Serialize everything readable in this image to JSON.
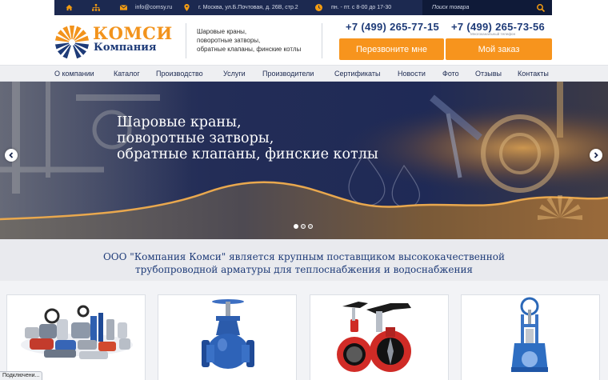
{
  "topbar": {
    "email": "info@comsy.ru",
    "address": "г. Москва, ул.Б.Почтовая, д. 26В, стр.2",
    "hours": "пн. - пт. с 8-00 до 17-30",
    "search_placeholder": "Поиск товара",
    "icon_color": "#f39c12"
  },
  "header": {
    "brand_line1": "КОМСИ",
    "brand_line2": "Компания",
    "tagline_1": "Шаровые краны,",
    "tagline_2": "поворотные затворы,",
    "tagline_3": "обратные клапаны, финские котлы",
    "phone_1": "+7 (499) 265-77-15",
    "phone_2": "+7 (499) 265-73-56",
    "phone_2_note": "Многоканальный телефон",
    "callback_label": "Перезвоните мне",
    "order_label": "Мой заказ",
    "accent_color": "#f7941d",
    "brand_color": "#1e3b78"
  },
  "nav": {
    "items": [
      "О компании",
      "Каталог",
      "Производство",
      "Услуги",
      "Производители",
      "Сертификаты",
      "Новости",
      "Фото",
      "Отзывы",
      "Контакты"
    ]
  },
  "hero": {
    "line_1": "Шаровые краны,",
    "line_2": "поворотные затворы,",
    "line_3": "обратные клапаны, финские котлы",
    "slide_count": 3,
    "active_slide": 1
  },
  "intro": {
    "line_1": "ООО \"Компания Комси\" является крупным поставщиком высококачественной",
    "line_2": "трубопроводной арматуры для теплоснабжения и водоснабжения"
  },
  "products": {
    "cards": [
      "ball-valves-card",
      "globe-valve-card",
      "butterfly-valve-card",
      "knife-gate-valve-card"
    ]
  },
  "status_bar": {
    "text": "Подключени..."
  }
}
